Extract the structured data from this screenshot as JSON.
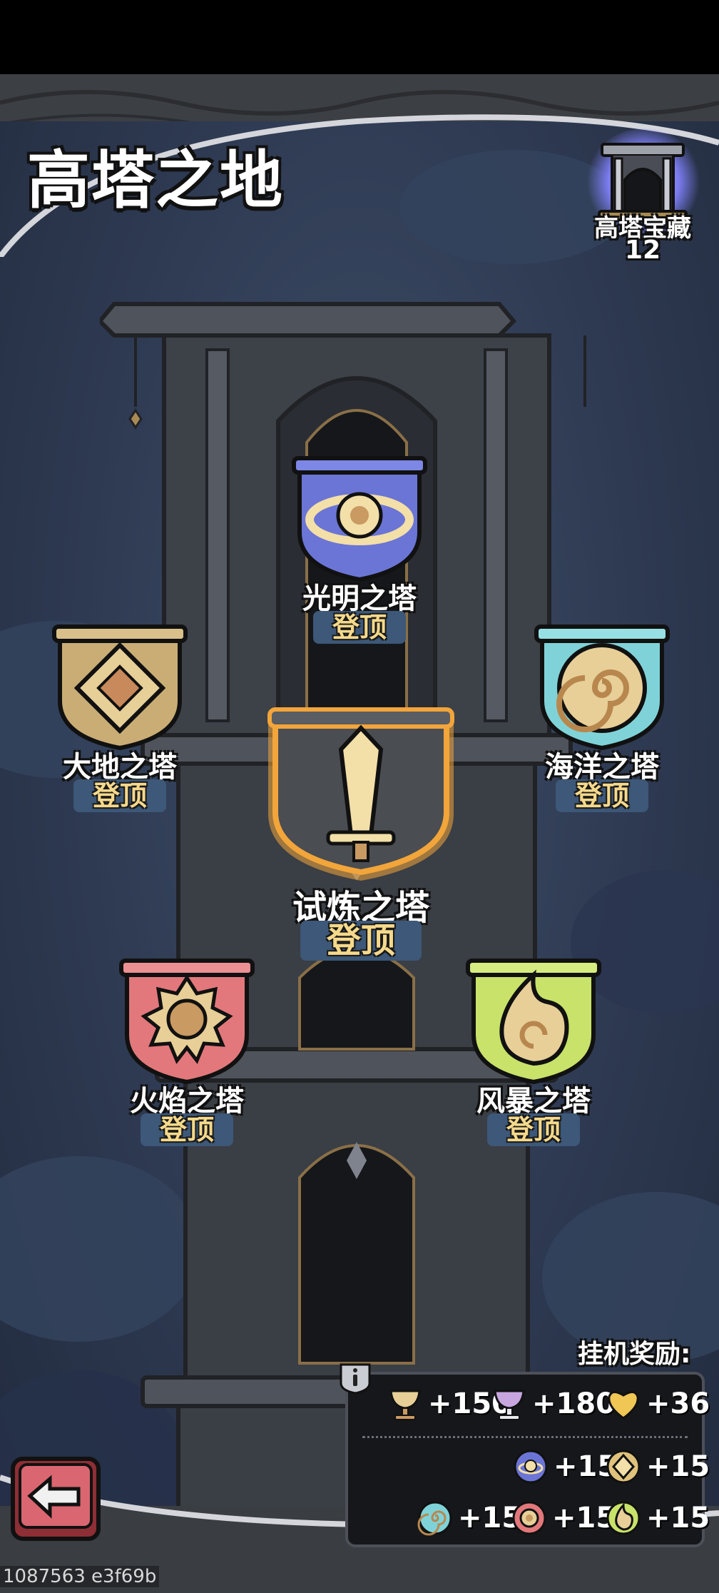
{
  "header": {
    "title": "高塔之地",
    "treasure_label": "高塔宝藏",
    "treasure_count": "12",
    "treasure_icon": "tower-gate-icon"
  },
  "towers": [
    {
      "id": "light",
      "label": "光明之塔",
      "status": "登顶",
      "icon": "orb-ring-icon",
      "banner_color": "#6b75d6"
    },
    {
      "id": "earth",
      "label": "大地之塔",
      "status": "登顶",
      "icon": "diamond-rune-icon",
      "banner_color": "#c9ad74"
    },
    {
      "id": "ocean",
      "label": "海洋之塔",
      "status": "登顶",
      "icon": "spiral-shell-icon",
      "banner_color": "#7fd3d8"
    },
    {
      "id": "trial",
      "label": "试炼之塔",
      "status": "登顶",
      "icon": "sword-icon",
      "banner_color": "#4a4d52"
    },
    {
      "id": "fire",
      "label": "火焰之塔",
      "status": "登顶",
      "icon": "sun-gear-icon",
      "banner_color": "#e2787b"
    },
    {
      "id": "storm",
      "label": "风暴之塔",
      "status": "登顶",
      "icon": "flame-swirl-icon",
      "banner_color": "#c8e26a"
    }
  ],
  "idle_rewards": {
    "title": "挂机奖励:",
    "row1": [
      {
        "icon": "gold-chalice-icon",
        "value": "+150"
      },
      {
        "icon": "purple-chalice-icon",
        "value": "+180"
      },
      {
        "icon": "gold-heart-icon",
        "value": "+36"
      }
    ],
    "row2": [
      {
        "icon": "light-orb-icon",
        "value": "+15"
      },
      {
        "icon": "earth-rune-icon",
        "value": "+15"
      }
    ],
    "row3": [
      {
        "icon": "ocean-shell-icon",
        "value": "+15"
      },
      {
        "icon": "fire-gear-icon",
        "value": "+15"
      },
      {
        "icon": "storm-flame-icon",
        "value": "+15"
      }
    ],
    "info_icon": "info-icon"
  },
  "back_button": {
    "icon": "back-arrow-icon"
  },
  "watermark": "1087563 e3f69b",
  "colors": {
    "sky": "#2e3a52",
    "frame": "#3a3d42",
    "status_text": "#f5d98b",
    "status_bg": "#3d5878",
    "trial_glow": "#f2a53a"
  }
}
